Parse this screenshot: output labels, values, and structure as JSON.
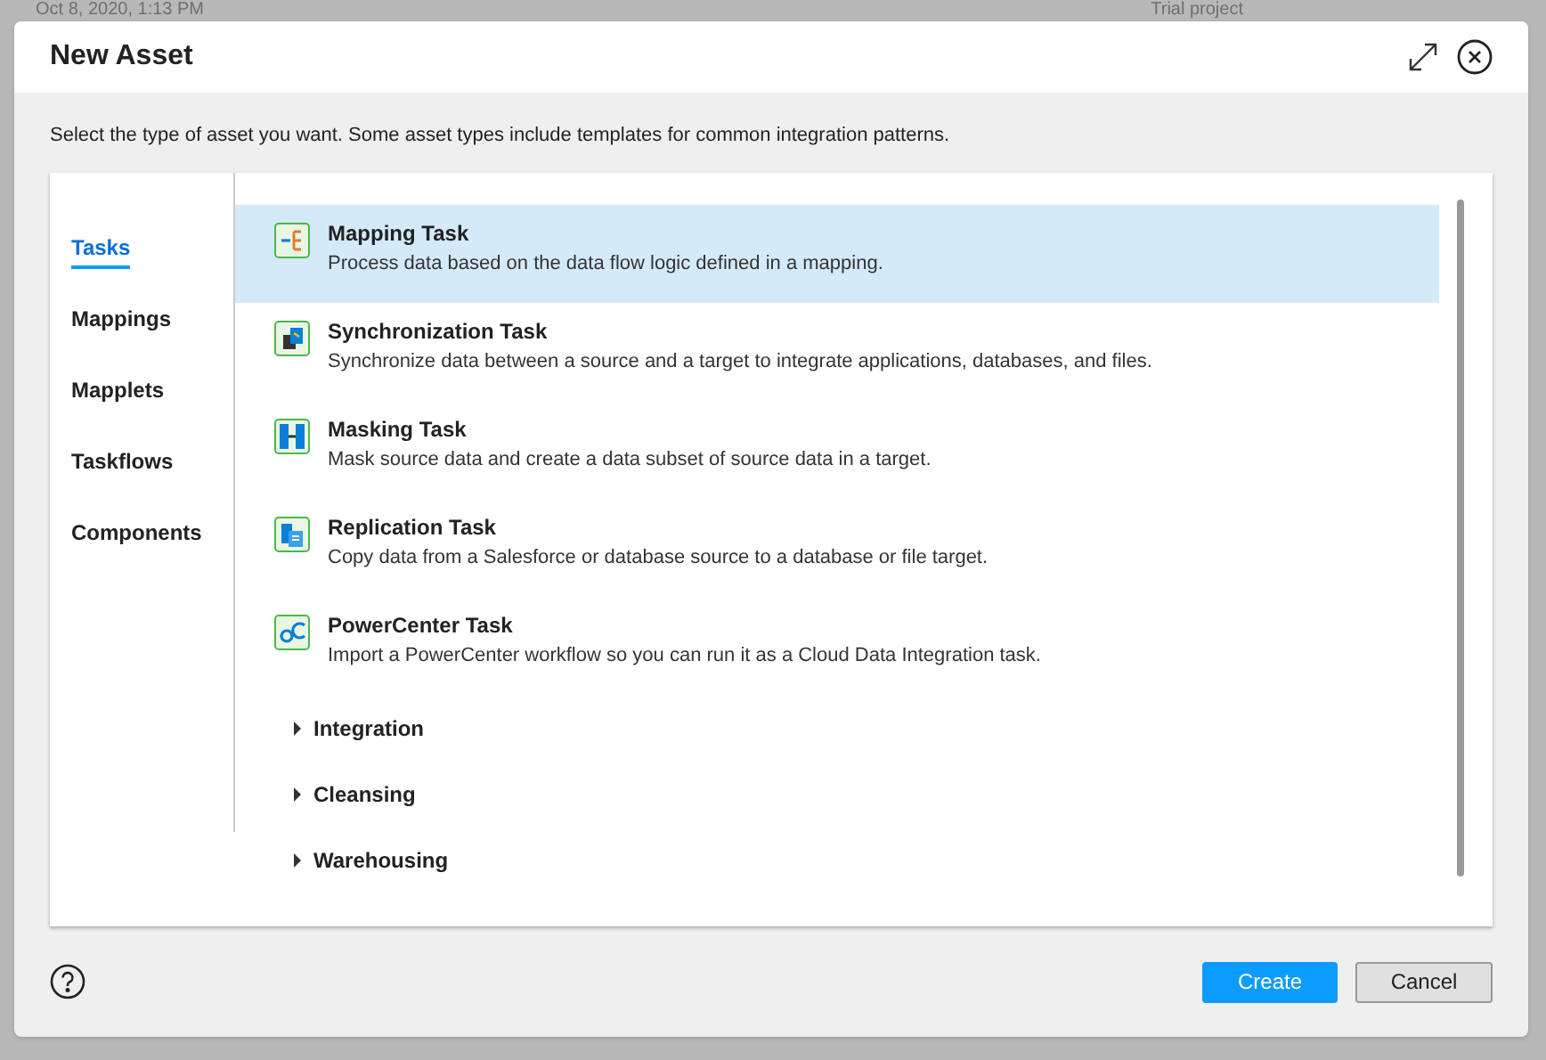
{
  "background": {
    "date": "Oct 8, 2020, 1:13 PM",
    "project": "Trial project"
  },
  "dialog": {
    "title": "New Asset",
    "description": "Select the type of asset you want. Some asset types include templates for common integration patterns."
  },
  "sidebar": {
    "items": [
      {
        "label": "Tasks",
        "selected": true
      },
      {
        "label": "Mappings",
        "selected": false
      },
      {
        "label": "Mapplets",
        "selected": false
      },
      {
        "label": "Taskflows",
        "selected": false
      },
      {
        "label": "Components",
        "selected": false
      }
    ]
  },
  "assets": [
    {
      "name": "Mapping Task",
      "description": "Process data based on the data flow logic defined in a mapping.",
      "selected": true
    },
    {
      "name": "Synchronization Task",
      "description": "Synchronize data between a source and a target to integrate applications, databases, and files.",
      "selected": false
    },
    {
      "name": "Masking Task",
      "description": "Mask source data and create a data subset of source data in a target.",
      "selected": false
    },
    {
      "name": "Replication Task",
      "description": "Copy data from a Salesforce or database source to a database or file target.",
      "selected": false
    },
    {
      "name": "PowerCenter Task",
      "description": "Import a PowerCenter workflow so you can run it as a Cloud Data Integration task.",
      "selected": false
    }
  ],
  "groups": [
    {
      "label": "Integration",
      "expanded": false
    },
    {
      "label": "Cleansing",
      "expanded": false
    },
    {
      "label": "Warehousing",
      "expanded": false
    }
  ],
  "buttons": {
    "create": "Create",
    "cancel": "Cancel"
  }
}
